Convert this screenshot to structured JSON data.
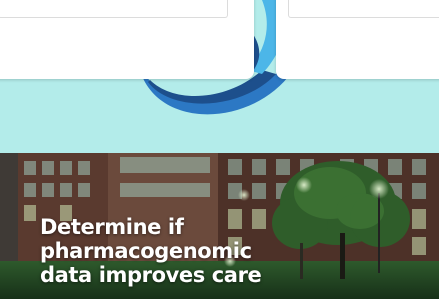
{
  "hero": {
    "caption": "Determine if\npharmacogenomic\ndata improves care"
  },
  "colors": {
    "band": "#b3ecea",
    "logo_dark": "#1d4f8c",
    "logo_mid": "#2c78c4",
    "logo_light": "#4cb6e8",
    "caption_text": "#ffffff"
  },
  "icons": {
    "logo": "swirl-logo-icon"
  }
}
